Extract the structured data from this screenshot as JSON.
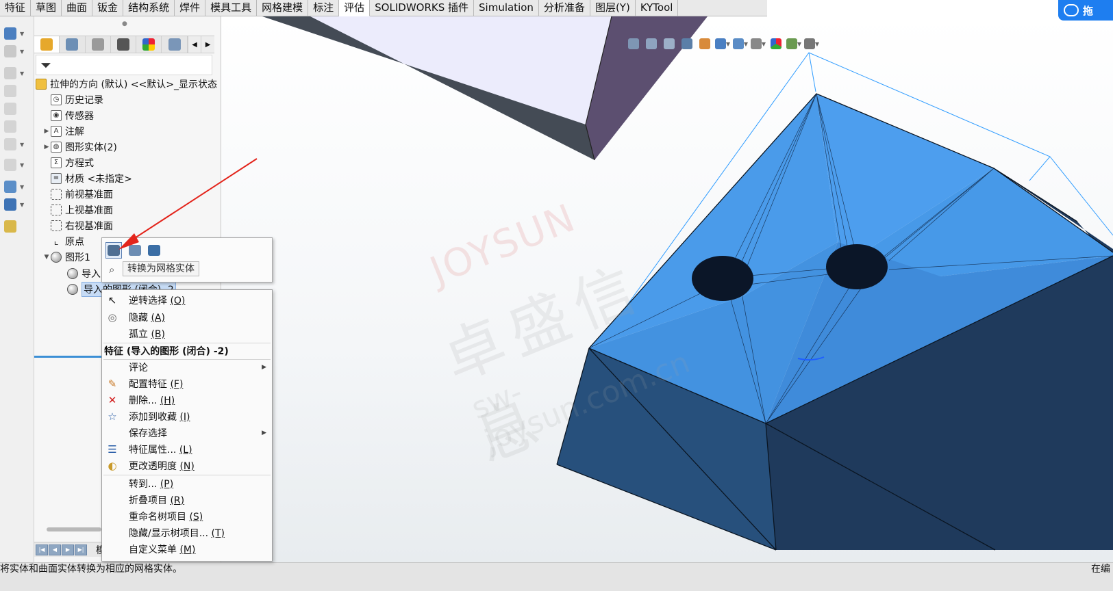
{
  "ribbon_tabs": [
    "特征",
    "草图",
    "曲面",
    "钣金",
    "结构系统",
    "焊件",
    "模具工具",
    "网格建模",
    "标注",
    "评估",
    "SOLIDWORKS 插件",
    "Simulation",
    "分析准备",
    "图层(Y)",
    "KYTool"
  ],
  "active_ribbon_tab": "评估",
  "feature_tree": {
    "root_label": "拉伸的方向 (默认) <<默认>_显示状态",
    "history": "历史记录",
    "sensors": "传感器",
    "annotations": "注解",
    "solid_bodies": "图形实体(2)",
    "equations": "方程式",
    "material": "材质 <未指定>",
    "front_plane": "前视基准面",
    "top_plane": "上视基准面",
    "right_plane": "右视基准面",
    "origin": "原点",
    "graphics1": "图形1",
    "import1": "导入",
    "import2": "导入的图形 (闭合) -2"
  },
  "bottom_tab_label": "模",
  "context_toolbar": {
    "tooltip": "转换为网格实体"
  },
  "context_menu": {
    "invert_selection": "逆转选择",
    "invert_selection_key": "(O)",
    "hide": "隐藏",
    "hide_key": "(A)",
    "isolate": "孤立",
    "isolate_key": "(B)",
    "header": "特征 (导入的图形 (闭合) -2)",
    "comment": "评论",
    "configure_feature": "配置特征",
    "configure_feature_key": "(F)",
    "delete": "删除...",
    "delete_key": "(H)",
    "add_to_favorites": "添加到收藏",
    "add_to_favorites_key": "(I)",
    "save_selection": "保存选择",
    "feature_properties": "特征属性...",
    "feature_properties_key": "(L)",
    "change_transparency": "更改透明度",
    "change_transparency_key": "(N)",
    "go_to": "转到...",
    "go_to_key": "(P)",
    "collapse_items": "折叠项目",
    "collapse_items_key": "(R)",
    "rename_tree_item": "重命名树项目",
    "rename_tree_item_key": "(S)",
    "hide_show_tree_items": "隐藏/显示树项目...",
    "hide_show_tree_items_key": "(T)",
    "customize_menu": "自定义菜单",
    "customize_menu_key": "(M)"
  },
  "watermark": {
    "brand": "JOYSUN",
    "chinese": "卓盛信息",
    "url": "sw-joysun.com.cn"
  },
  "corner_button_text": "拖",
  "status": {
    "message": "将实体和曲面实体转换为相应的网格实体。",
    "right": "在编"
  },
  "colors": {
    "model_top": "#4a9bea",
    "model_side_dark": "#1f3a5c",
    "model_side_mid": "#27507c",
    "upper_plate_face": "#e8e8fb",
    "upper_plate_side": "#5c4f70",
    "bbox_line": "#2f9cff",
    "annotation_arrow": "#e3241b",
    "corner_button": "#1e7ef0"
  }
}
